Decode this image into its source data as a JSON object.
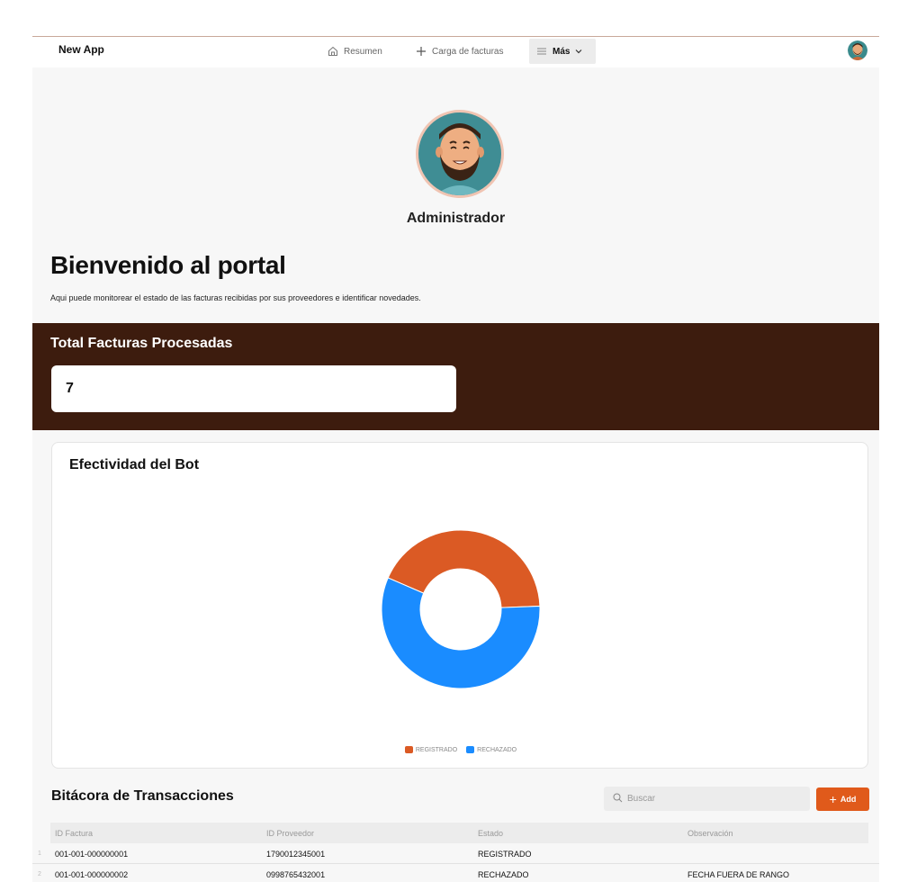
{
  "app": {
    "title": "New App"
  },
  "nav": {
    "items": [
      {
        "label": "Resumen",
        "icon": "home-icon"
      },
      {
        "label": "Carga de facturas",
        "icon": "plus-icon"
      },
      {
        "label": "Más",
        "icon": "menu-icon"
      }
    ]
  },
  "profile": {
    "name": "Administrador"
  },
  "page": {
    "title": "Bienvenido al portal",
    "subtitle": "Aqui puede monitorear el estado de las facturas recibidas por sus proveedores e identificar novedades."
  },
  "total": {
    "label": "Total Facturas Procesadas",
    "value": "7"
  },
  "chart": {
    "title": "Efectividad del Bot"
  },
  "chart_data": {
    "type": "pie",
    "title": "Efectividad del Bot",
    "donut": true,
    "legend_position": "bottom",
    "series": [
      {
        "name": "REGISTRADO",
        "value": 3,
        "color": "#db5a24"
      },
      {
        "name": "RECHAZADO",
        "value": 4,
        "color": "#1a8cff"
      }
    ]
  },
  "table": {
    "title": "Bitácora de Transacciones",
    "search_placeholder": "Buscar",
    "add_label": "Add",
    "columns": [
      "ID Factura",
      "ID Proveedor",
      "Estado",
      "Observación"
    ],
    "rows": [
      {
        "index": "1",
        "id_factura": "001-001-000000001",
        "id_proveedor": "1790012345001",
        "estado": "REGISTRADO",
        "observacion": ""
      },
      {
        "index": "2",
        "id_factura": "001-001-000000002",
        "id_proveedor": "0998765432001",
        "estado": "RECHAZADO",
        "observacion": "FECHA FUERA DE RANGO"
      }
    ]
  }
}
